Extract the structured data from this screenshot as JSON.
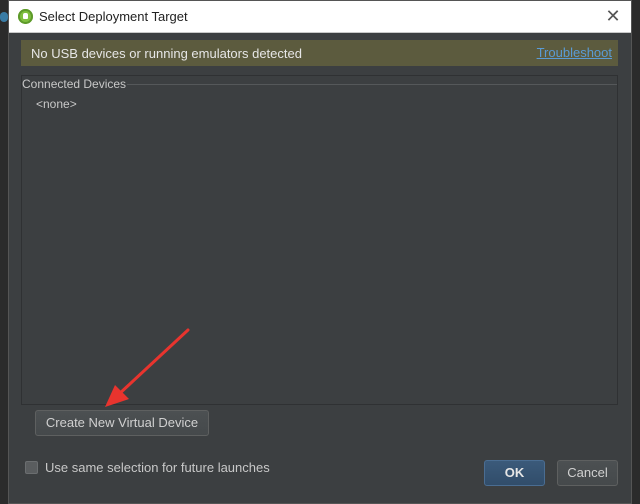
{
  "dialog": {
    "title": "Select Deployment Target",
    "title_icon": "android-studio-icon",
    "close_icon": "close-icon"
  },
  "notice": {
    "message": "No USB devices or running emulators detected",
    "link_label": "Troubleshoot"
  },
  "devices": {
    "group_label": "Connected Devices",
    "items": [
      "<none>"
    ]
  },
  "actions": {
    "create_label": "Create New Virtual Device",
    "checkbox_label": "Use same selection for future launches",
    "checkbox_checked": false,
    "ok_label": "OK",
    "cancel_label": "Cancel"
  },
  "colors": {
    "dialog_bg": "#3c3f41",
    "notice_bg": "#5c5b3e",
    "link": "#5a9bd5",
    "ok_bg": "#365880",
    "annotation_arrow": "#e8342e"
  }
}
